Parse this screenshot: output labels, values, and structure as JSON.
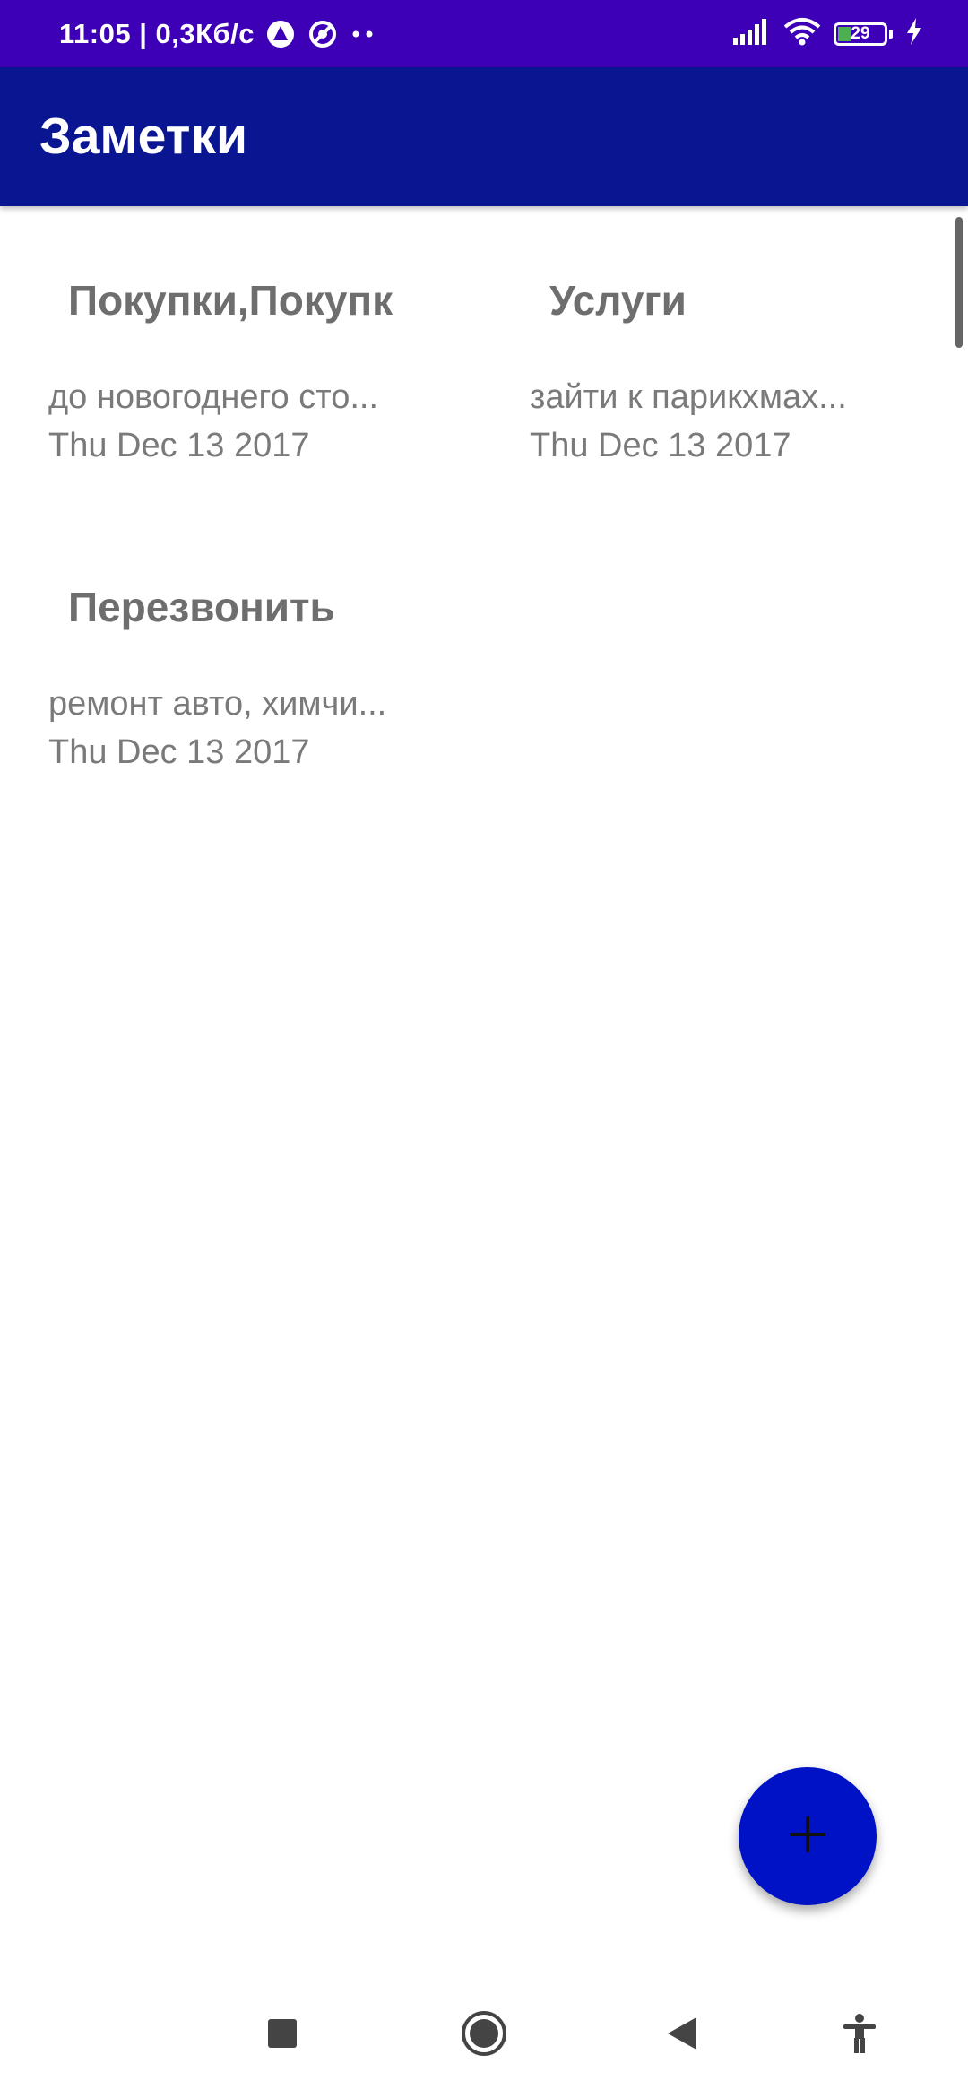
{
  "status_bar": {
    "time_speed": "11:05 | 0,3Кб/с",
    "battery_level": "29",
    "icons": [
      "autopilot-icon",
      "data-saver-icon",
      "more-dots-icon",
      "signal-icon",
      "wifi-icon",
      "battery-icon",
      "charging-icon"
    ]
  },
  "app_bar": {
    "title": "Заметки"
  },
  "notes": [
    {
      "title": "Покупки,Покупк",
      "text": "до новогоднего сто...",
      "date": "Thu Dec 13 2017"
    },
    {
      "title": "Услуги",
      "text": "зайти к парикхмах...",
      "date": "Thu Dec 13 2017"
    },
    {
      "title": "Перезвонить",
      "text": "ремонт авто, химчи...",
      "date": "Thu Dec 13 2017"
    }
  ],
  "fab": {
    "icon": "plus-icon"
  },
  "nav_bar": {
    "icons": [
      "recents-square-icon",
      "home-circle-icon",
      "back-triangle-icon",
      "accessibility-icon"
    ]
  },
  "colors": {
    "status_bar": "#3d00b6",
    "app_bar": "#0a1591",
    "fab": "#0012c6",
    "note_text": "#7a7a7a"
  }
}
